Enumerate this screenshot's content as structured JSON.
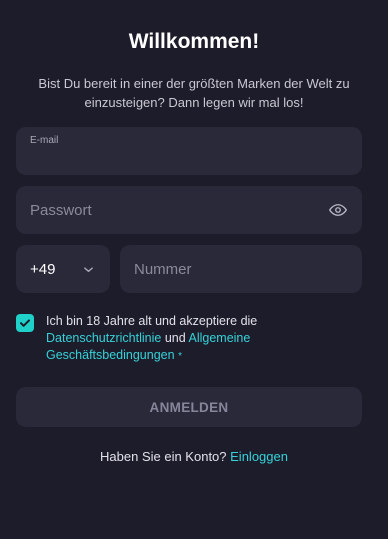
{
  "header": {
    "title": "Willkommen!",
    "subtitle": "Bist Du bereit in einer der größten Marken der Welt zu einzusteigen? Dann legen wir mal los!"
  },
  "form": {
    "email": {
      "label": "E-mail",
      "value": ""
    },
    "password": {
      "placeholder": "Passwort",
      "value": "",
      "toggle_icon": "eye-icon"
    },
    "phone": {
      "country_code": "+49",
      "dropdown_icon": "chevron-down-icon",
      "placeholder": "Nummer",
      "value": ""
    },
    "consent": {
      "checked": true,
      "text_before": "Ich bin 18 Jahre alt und akzeptiere die",
      "privacy_link": "Datenschutzrichtlinie",
      "and": "und",
      "terms_link": "Allgemeine Geschäftsbedingungen",
      "required_mark": "*"
    },
    "submit_label": "ANMELDEN"
  },
  "footer": {
    "question": "Haben Sie ein Konto?",
    "login_link": "Einloggen"
  },
  "colors": {
    "background": "#1d1c2a",
    "field": "#2a2939",
    "accent": "#1fd1c8",
    "link": "#35d2d8"
  }
}
